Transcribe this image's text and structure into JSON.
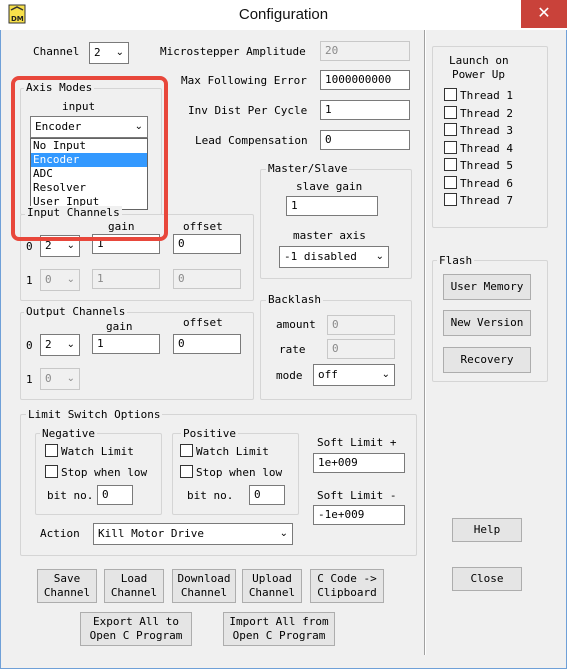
{
  "window": {
    "title": "Configuration",
    "close_glyph": "✕",
    "icon": "dynomotion-app-icon"
  },
  "channel": {
    "label": "Channel",
    "value": "2"
  },
  "microstepper": {
    "label": "Microstepper Amplitude",
    "value": "20"
  },
  "max_following_error": {
    "label": "Max Following Error",
    "value": "1000000000"
  },
  "inv_dist": {
    "label": "Inv Dist Per Cycle",
    "value": "1"
  },
  "lead_comp": {
    "label": "Lead Compensation",
    "value": "0"
  },
  "axis_modes": {
    "title": "Axis Modes",
    "input_label": "input",
    "selected": "Encoder",
    "options": [
      "No Input",
      "Encoder",
      "ADC",
      "Resolver",
      "User Input"
    ],
    "highlighted_index": 1
  },
  "input_channels": {
    "title": "Input Channels",
    "gain_label": "gain",
    "offset_label": "offset",
    "row0": {
      "index": "0",
      "channel": "2",
      "gain": "1",
      "offset": "0"
    },
    "row1": {
      "index": "1",
      "channel": "0",
      "gain": "1",
      "offset": "0"
    }
  },
  "output_channels": {
    "title": "Output Channels",
    "gain_label": "gain",
    "offset_label": "offset",
    "row0": {
      "index": "0",
      "channel": "2",
      "gain": "1",
      "offset": "0"
    },
    "row1": {
      "index": "1",
      "channel": "0"
    }
  },
  "master_slave": {
    "title": "Master/Slave",
    "slave_gain_label": "slave gain",
    "slave_gain": "1",
    "master_axis_label": "master axis",
    "master_axis": "-1 disabled"
  },
  "backlash": {
    "title": "Backlash",
    "amount_label": "amount",
    "amount": "0",
    "rate_label": "rate",
    "rate": "0",
    "mode_label": "mode",
    "mode": "off"
  },
  "limit_switch": {
    "title": "Limit Switch Options",
    "negative": {
      "title": "Negative",
      "watch": "Watch Limit",
      "stop": "Stop when low",
      "bit_label": "bit no.",
      "bit": "0"
    },
    "positive": {
      "title": "Positive",
      "watch": "Watch Limit",
      "stop": "Stop when low",
      "bit_label": "bit no.",
      "bit": "0"
    },
    "soft_plus_label": "Soft Limit +",
    "soft_plus": "1e+009",
    "soft_minus_label": "Soft Limit -",
    "soft_minus": "-1e+009",
    "action_label": "Action",
    "action": "Kill Motor Drive"
  },
  "launch": {
    "title_line1": "Launch on",
    "title_line2": "Power Up",
    "threads": [
      "Thread 1",
      "Thread 2",
      "Thread 3",
      "Thread 4",
      "Thread 5",
      "Thread 6",
      "Thread 7"
    ]
  },
  "flash": {
    "title": "Flash",
    "user_memory": "User Memory",
    "new_version": "New Version",
    "recovery": "Recovery"
  },
  "buttons": {
    "save_1": "Save",
    "save_2": "Channel",
    "load_1": "Load",
    "load_2": "Channel",
    "download_1": "Download",
    "download_2": "Channel",
    "upload_1": "Upload",
    "upload_2": "Channel",
    "ccode_1": "C Code ->",
    "ccode_2": "Clipboard",
    "export_1": "Export All to",
    "export_2": "Open C Program",
    "import_1": "Import All from",
    "import_2": "Open C Program",
    "help": "Help",
    "close": "Close"
  },
  "dropdown_arrow": "⌄",
  "colors": {
    "title_bar": "#ffffff",
    "close_button": "#c9423a",
    "selection": "#3399ff",
    "highlight_outline": "#e8473b",
    "window_bg": "#f0f0f0"
  }
}
